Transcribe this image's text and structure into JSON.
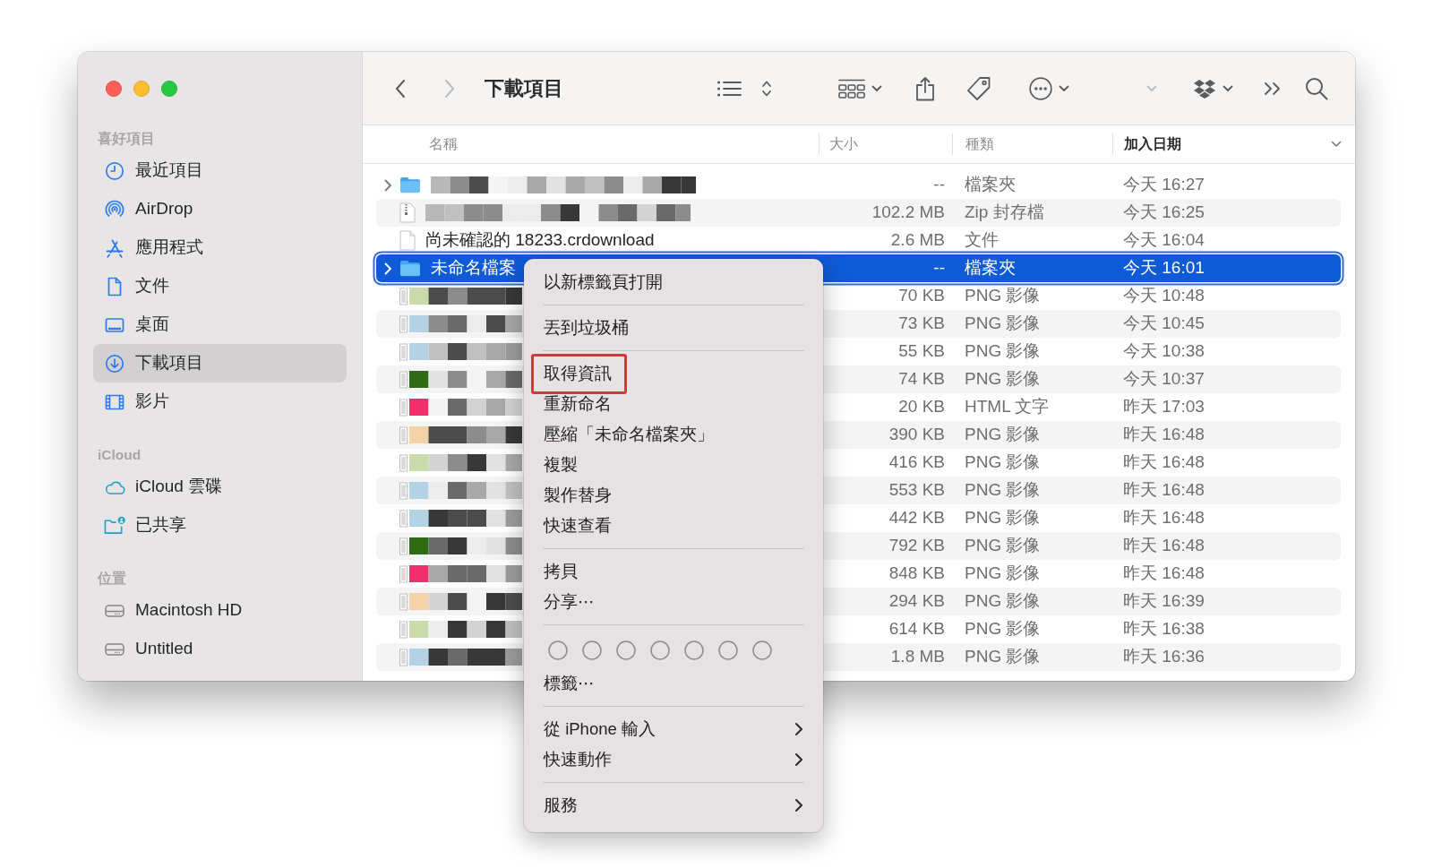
{
  "window": {
    "title": "下載項目"
  },
  "toolbar": {
    "back": {
      "disabled": false
    },
    "forward": {
      "disabled": true
    },
    "buttons": [
      {
        "kind": "view",
        "disabled": false
      },
      {
        "kind": "group",
        "disabled": false
      },
      {
        "kind": "share",
        "disabled": false
      },
      {
        "kind": "tag",
        "disabled": false
      },
      {
        "kind": "action",
        "disabled": false
      },
      {
        "kind": "dropdown",
        "disabled": true
      },
      {
        "kind": "dropbox",
        "disabled": false
      },
      {
        "kind": "overflow",
        "disabled": false
      },
      {
        "kind": "search",
        "disabled": false
      }
    ]
  },
  "sidebar": {
    "sections": [
      {
        "title": "喜好項目",
        "items": [
          {
            "label": "最近項目",
            "kind": "recents",
            "selected": false
          },
          {
            "label": "AirDrop",
            "kind": "airdrop",
            "selected": false
          },
          {
            "label": "應用程式",
            "kind": "applications",
            "selected": false
          },
          {
            "label": "文件",
            "kind": "documents",
            "selected": false
          },
          {
            "label": "桌面",
            "kind": "desktop",
            "selected": false
          },
          {
            "label": "下載項目",
            "kind": "downloads",
            "selected": true
          },
          {
            "label": "影片",
            "kind": "movies",
            "selected": false
          }
        ]
      },
      {
        "title": "iCloud",
        "items": [
          {
            "label": "iCloud 雲碟",
            "kind": "icloud_drive",
            "selected": false
          },
          {
            "label": "已共享",
            "kind": "shared",
            "selected": false
          }
        ]
      },
      {
        "title": "位置",
        "items": [
          {
            "label": "Macintosh HD",
            "kind": "disk",
            "selected": false
          },
          {
            "label": "Untitled",
            "kind": "disk",
            "selected": false
          }
        ]
      }
    ]
  },
  "table": {
    "columns": [
      {
        "label": "名稱",
        "sorted": false
      },
      {
        "label": "大小",
        "sorted": false
      },
      {
        "label": "種類",
        "sorted": false
      },
      {
        "label": "加入日期",
        "sorted": true
      }
    ],
    "rows": [
      {
        "kind": "folder",
        "expandable": true,
        "pixelated": true,
        "size": "--",
        "file_type": "檔案夾",
        "date_added": "今天 16:27",
        "selected": false
      },
      {
        "kind": "zip",
        "expandable": false,
        "pixelated": true,
        "size": "102.2 MB",
        "file_type": "Zip 封存檔",
        "date_added": "今天 16:25",
        "selected": false
      },
      {
        "kind": "document",
        "expandable": false,
        "pixelated": false,
        "name": "尚未確認的 18233.crdownload",
        "size": "2.6 MB",
        "file_type": "文件",
        "date_added": "今天 16:04",
        "selected": false
      },
      {
        "kind": "folder",
        "expandable": true,
        "pixelated": false,
        "name": "未命名檔案",
        "size": "--",
        "file_type": "檔案夾",
        "date_added": "今天 16:01",
        "selected": true
      },
      {
        "kind": "image",
        "expandable": false,
        "pixelated": true,
        "size": "70 KB",
        "file_type": "PNG 影像",
        "date_added": "今天 10:48",
        "selected": false
      },
      {
        "kind": "image",
        "expandable": false,
        "pixelated": true,
        "size": "73 KB",
        "file_type": "PNG 影像",
        "date_added": "今天 10:45",
        "selected": false
      },
      {
        "kind": "image",
        "expandable": false,
        "pixelated": true,
        "size": "55 KB",
        "file_type": "PNG 影像",
        "date_added": "今天 10:38",
        "selected": false
      },
      {
        "kind": "image",
        "expandable": false,
        "pixelated": true,
        "size": "74 KB",
        "file_type": "PNG 影像",
        "date_added": "今天 10:37",
        "selected": false
      },
      {
        "kind": "html",
        "expandable": false,
        "pixelated": true,
        "size": "20 KB",
        "file_type": "HTML 文字",
        "date_added": "昨天 17:03",
        "selected": false
      },
      {
        "kind": "image",
        "expandable": false,
        "pixelated": true,
        "size": "390 KB",
        "file_type": "PNG 影像",
        "date_added": "昨天 16:48",
        "selected": false
      },
      {
        "kind": "image",
        "expandable": false,
        "pixelated": true,
        "size": "416 KB",
        "file_type": "PNG 影像",
        "date_added": "昨天 16:48",
        "selected": false
      },
      {
        "kind": "image",
        "expandable": false,
        "pixelated": true,
        "size": "553 KB",
        "file_type": "PNG 影像",
        "date_added": "昨天 16:48",
        "selected": false
      },
      {
        "kind": "image",
        "expandable": false,
        "pixelated": true,
        "size": "442 KB",
        "file_type": "PNG 影像",
        "date_added": "昨天 16:48",
        "selected": false
      },
      {
        "kind": "image",
        "expandable": false,
        "pixelated": true,
        "size": "792 KB",
        "file_type": "PNG 影像",
        "date_added": "昨天 16:48",
        "selected": false
      },
      {
        "kind": "image",
        "expandable": false,
        "pixelated": true,
        "size": "848 KB",
        "file_type": "PNG 影像",
        "date_added": "昨天 16:48",
        "selected": false
      },
      {
        "kind": "image",
        "expandable": false,
        "pixelated": true,
        "size": "294 KB",
        "file_type": "PNG 影像",
        "date_added": "昨天 16:39",
        "selected": false
      },
      {
        "kind": "image",
        "expandable": false,
        "pixelated": true,
        "size": "614 KB",
        "file_type": "PNG 影像",
        "date_added": "昨天 16:38",
        "selected": false
      },
      {
        "kind": "image",
        "expandable": false,
        "pixelated": true,
        "size": "1.8 MB",
        "file_type": "PNG 影像",
        "date_added": "昨天 16:36",
        "selected": false
      }
    ]
  },
  "context_menu": {
    "items": [
      {
        "kind": "item",
        "label": "以新標籤頁打開",
        "submenu": false,
        "highlighted": false
      },
      {
        "kind": "separator"
      },
      {
        "kind": "item",
        "label": "丟到垃圾桶",
        "submenu": false,
        "highlighted": false
      },
      {
        "kind": "separator"
      },
      {
        "kind": "item",
        "label": "取得資訊",
        "submenu": false,
        "highlighted": true
      },
      {
        "kind": "item",
        "label": "重新命名",
        "submenu": false,
        "highlighted": false
      },
      {
        "kind": "item",
        "label": "壓縮「未命名檔案夾」",
        "submenu": false,
        "highlighted": false
      },
      {
        "kind": "item",
        "label": "複製",
        "submenu": false,
        "highlighted": false
      },
      {
        "kind": "item",
        "label": "製作替身",
        "submenu": false,
        "highlighted": false
      },
      {
        "kind": "item",
        "label": "快速查看",
        "submenu": false,
        "highlighted": false
      },
      {
        "kind": "separator"
      },
      {
        "kind": "item",
        "label": "拷貝",
        "submenu": false,
        "highlighted": false
      },
      {
        "kind": "item",
        "label": "分享⋯",
        "submenu": false,
        "highlighted": false
      },
      {
        "kind": "separator"
      },
      {
        "kind": "tags",
        "tags": [
          {
            "selected": false
          },
          {
            "selected": false
          },
          {
            "selected": false
          },
          {
            "selected": false
          },
          {
            "selected": false
          },
          {
            "selected": false
          },
          {
            "selected": false
          }
        ]
      },
      {
        "kind": "item",
        "label": "標籤⋯",
        "submenu": false,
        "highlighted": false
      },
      {
        "kind": "separator"
      },
      {
        "kind": "item",
        "label": "從 iPhone 輸入",
        "submenu": true,
        "highlighted": false
      },
      {
        "kind": "item",
        "label": "快速動作",
        "submenu": true,
        "highlighted": false
      },
      {
        "kind": "separator"
      },
      {
        "kind": "item",
        "label": "服務",
        "submenu": true,
        "highlighted": false
      }
    ]
  }
}
